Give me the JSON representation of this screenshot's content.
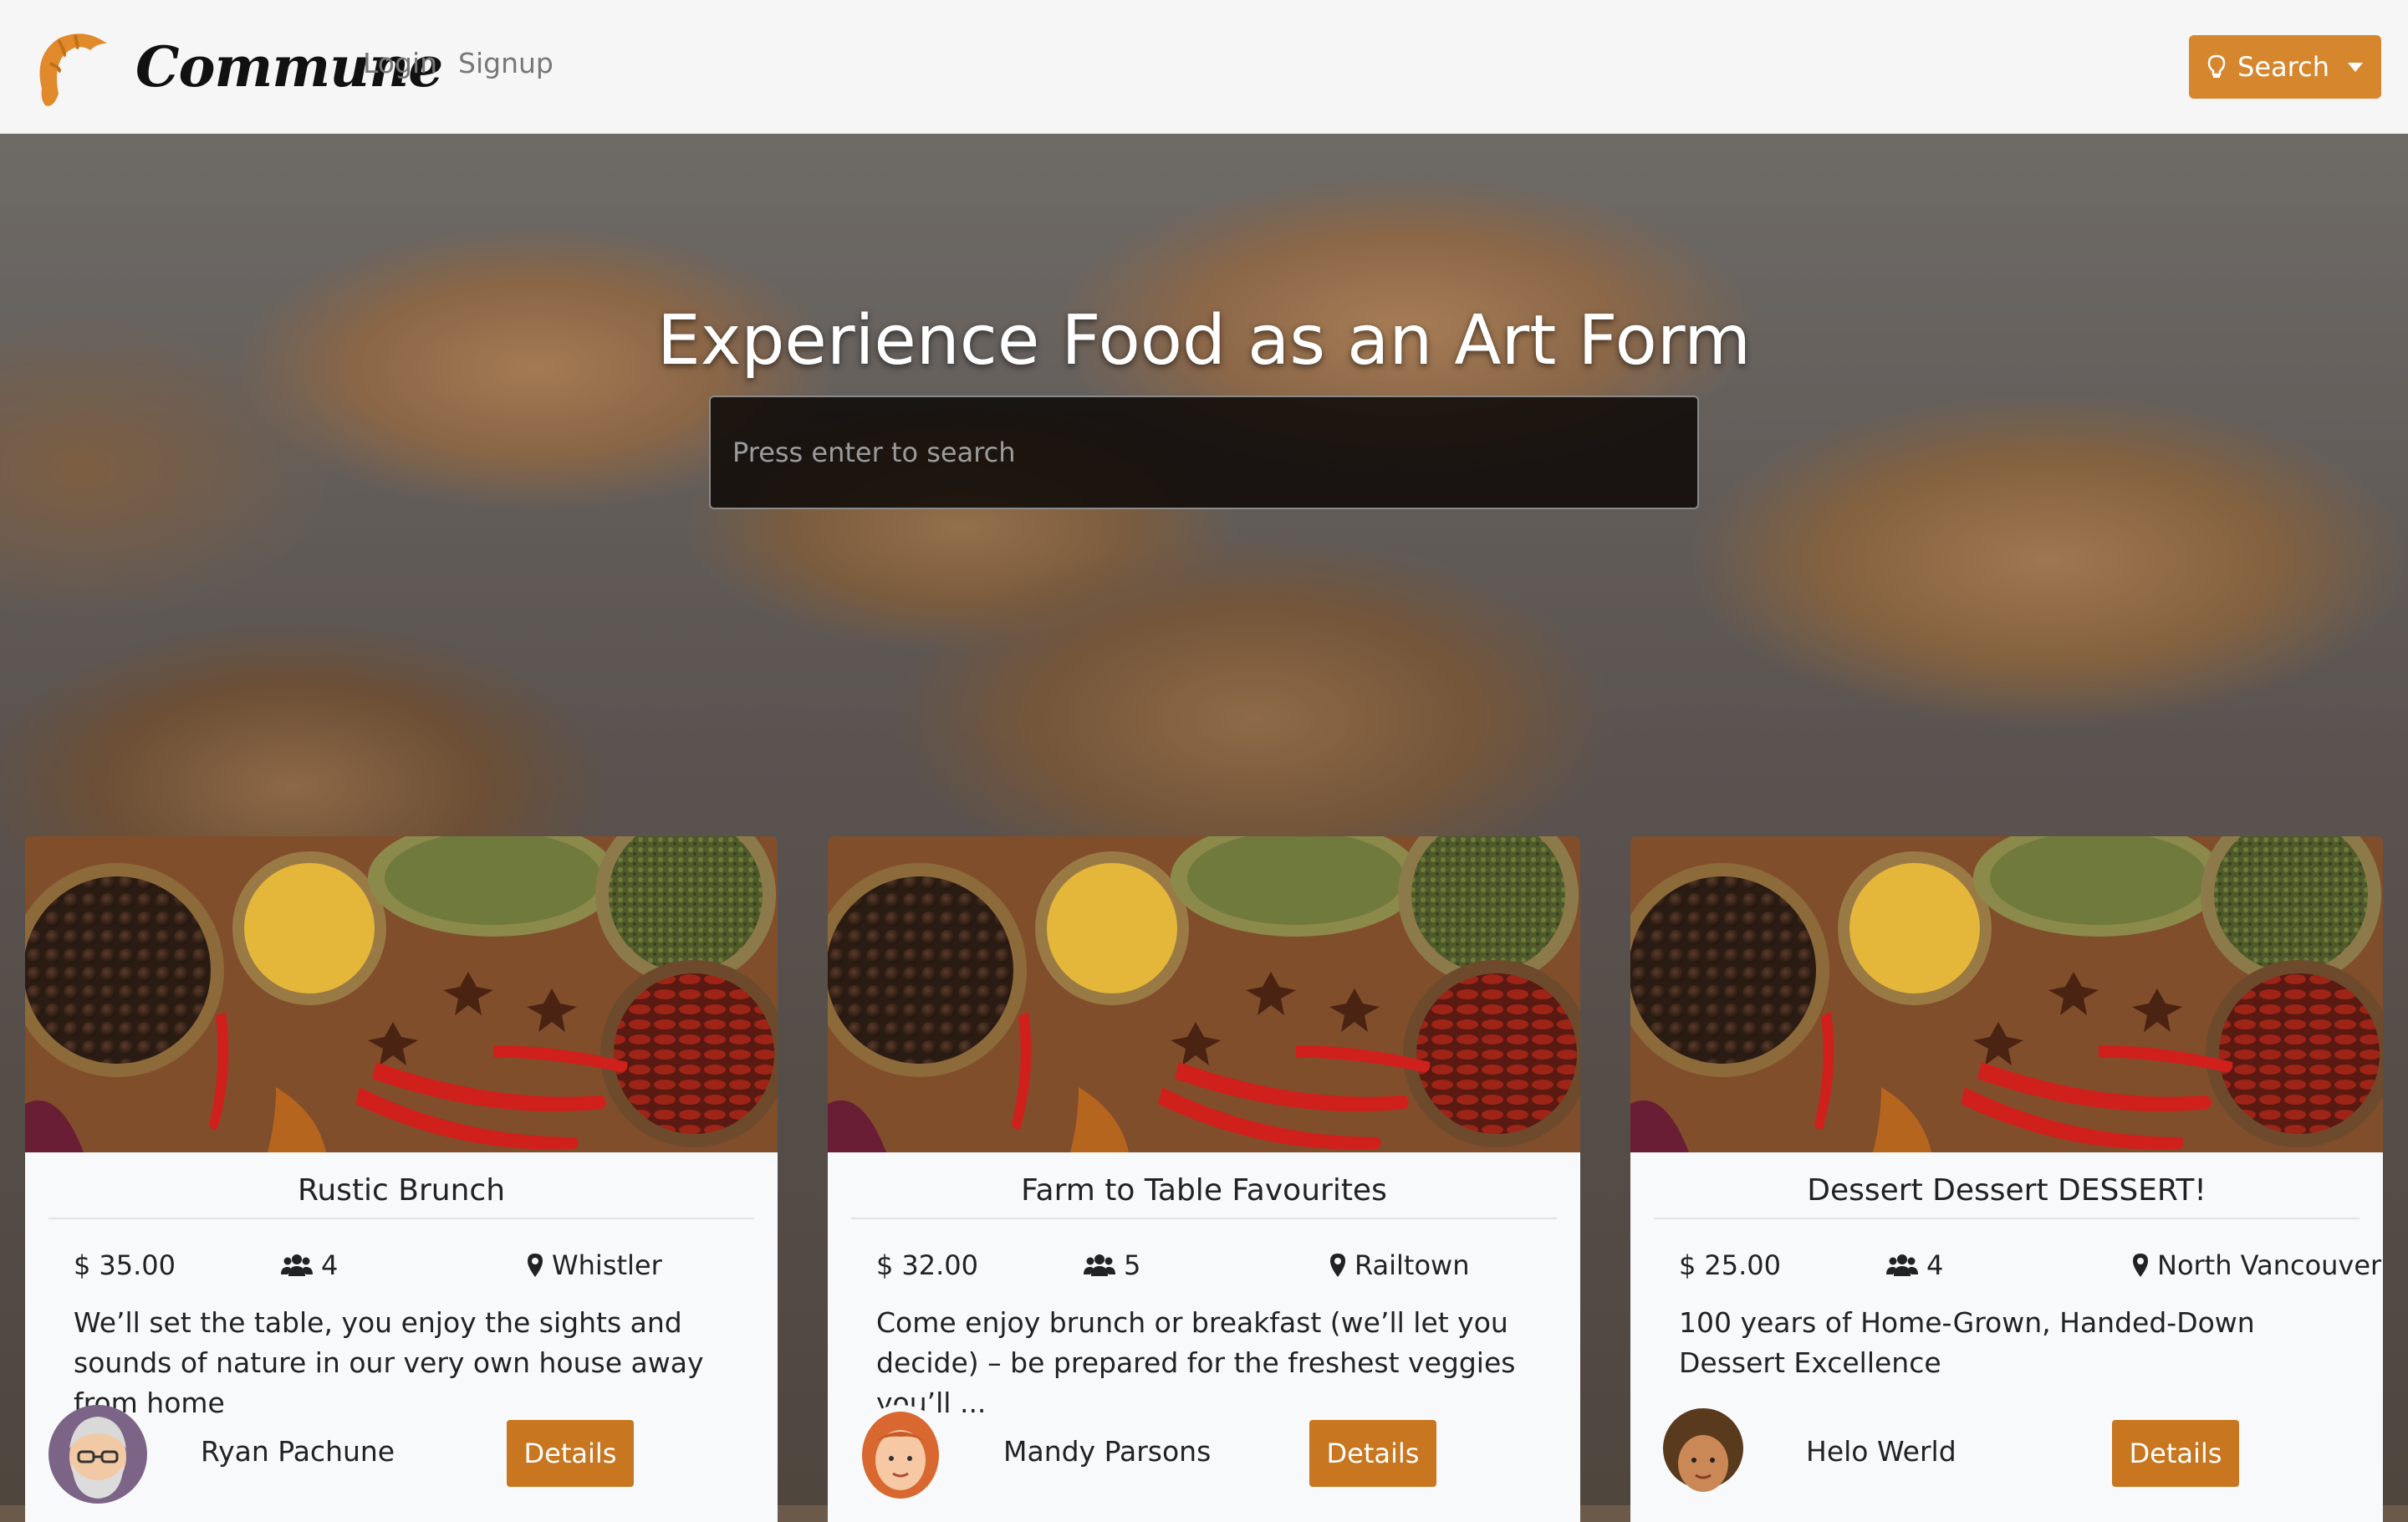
{
  "brand": {
    "name": "Commune",
    "accent_color": "#d6872e"
  },
  "nav": {
    "login": "Login",
    "signup": "Signup"
  },
  "search_button": {
    "label": "Search",
    "icon": "lightbulb-icon"
  },
  "hero": {
    "title": "Experience Food as an Art Form",
    "search_placeholder": "Press enter to search"
  },
  "cards": [
    {
      "title": "Rustic Brunch",
      "price": "35.00",
      "guests": "4",
      "location": "Whistler",
      "description": "We’ll set the table, you enjoy the sights and sounds of nature in our very own house away from home",
      "host": "Ryan Pachune",
      "details_label": "Details"
    },
    {
      "title": "Farm to Table Favourites",
      "price": "32.00",
      "guests": "5",
      "location": "Railtown",
      "description": "Come enjoy brunch or breakfast (we’ll let you decide) – be prepared for the freshest veggies you’ll ...",
      "host": "Mandy Parsons",
      "details_label": "Details"
    },
    {
      "title": "Dessert Dessert DESSERT!",
      "price": "25.00",
      "guests": "4",
      "location": "North Vancouver",
      "description": "100 years of Home-Grown, Handed-Down Dessert Excellence",
      "host": "Helo Werld",
      "details_label": "Details"
    }
  ],
  "icons": {
    "price": "dollar-icon",
    "guests": "users-icon",
    "location": "map-marker-icon"
  }
}
